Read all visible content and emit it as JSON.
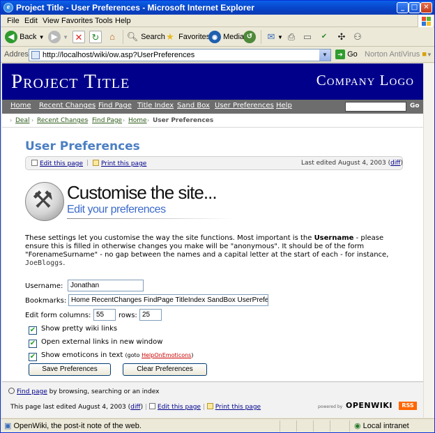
{
  "window": {
    "title": "Project Title - User Preferences - Microsoft Internet Explorer",
    "controls": {
      "minimize": "_",
      "maximize": "□",
      "close": "✕"
    }
  },
  "menu": [
    "File",
    "Edit",
    "View",
    "Favorites",
    "Tools",
    "Help"
  ],
  "toolbar": {
    "back": "Back",
    "search": "Search",
    "favorites": "Favorites",
    "media": "Media"
  },
  "address": {
    "label": "Address",
    "url": "http://localhost/wiki/ow.asp?UserPreferences",
    "go": "Go",
    "antivirus": "Norton AntiVirus"
  },
  "site": {
    "project_title": "Project Title",
    "company_logo": "Company Logo",
    "nav": [
      "Home",
      "Recent Changes",
      "Find Page",
      "Title Index",
      "Sand Box",
      "User Preferences",
      "Help"
    ],
    "nav_go": "Go",
    "breadcrumbs": [
      "Deal",
      "Recent Changes",
      "Find Page",
      "Home"
    ],
    "breadcrumb_current": "User Preferences"
  },
  "page": {
    "heading": "User Preferences",
    "edit_link": "Edit this page",
    "print_link": "Print this page",
    "last_edited": "Last edited August 4, 2003",
    "diff": "diff",
    "hero_title": "Customise the site...",
    "hero_subtitle": "Edit your preferences",
    "intro_part1": "These settings let you customise the way the site functions. Most important is the ",
    "intro_bold": "Username",
    "intro_part2": " - please ensure this is filled in otherwise changes you make will be \"anonymous\". It should be of the form \"ForenameSurname\" - no gap between the names and a capital letter at the start of each - for instance, ",
    "intro_example": "JoeBloggs",
    "intro_end": "."
  },
  "form": {
    "username_label": "Username:",
    "username_value": "Jonathan",
    "bookmarks_label": "Bookmarks:",
    "bookmarks_value": "Home RecentChanges FindPage TitleIndex SandBox UserPreferences",
    "cols_label": "Edit form columns:",
    "cols_value": "55",
    "rows_label": "rows:",
    "rows_value": "25",
    "pretty_links": "Show pretty wiki links",
    "external_links": "Open external links in new window",
    "emoticons": "Show emoticons in text",
    "goto_text": "(goto ",
    "goto_link": "HelpOnEmoticons",
    "goto_end": ")",
    "save_button": "Save Preferences",
    "clear_button": "Clear Preferences"
  },
  "footer": {
    "find_page": "Find page",
    "find_text": " by browsing, searching or an index",
    "last_edited": "This page last edited August 4, 2003 (",
    "diff": "diff",
    "last_edited_end": ")",
    "edit_link": "Edit this page",
    "print_link": "Print this page",
    "powered_by": "powered by",
    "openwiki": "OPENWIKI",
    "rss": "RSS"
  },
  "status": {
    "text": "OpenWiki, the post-it note of the web.",
    "zone": "Local intranet"
  }
}
